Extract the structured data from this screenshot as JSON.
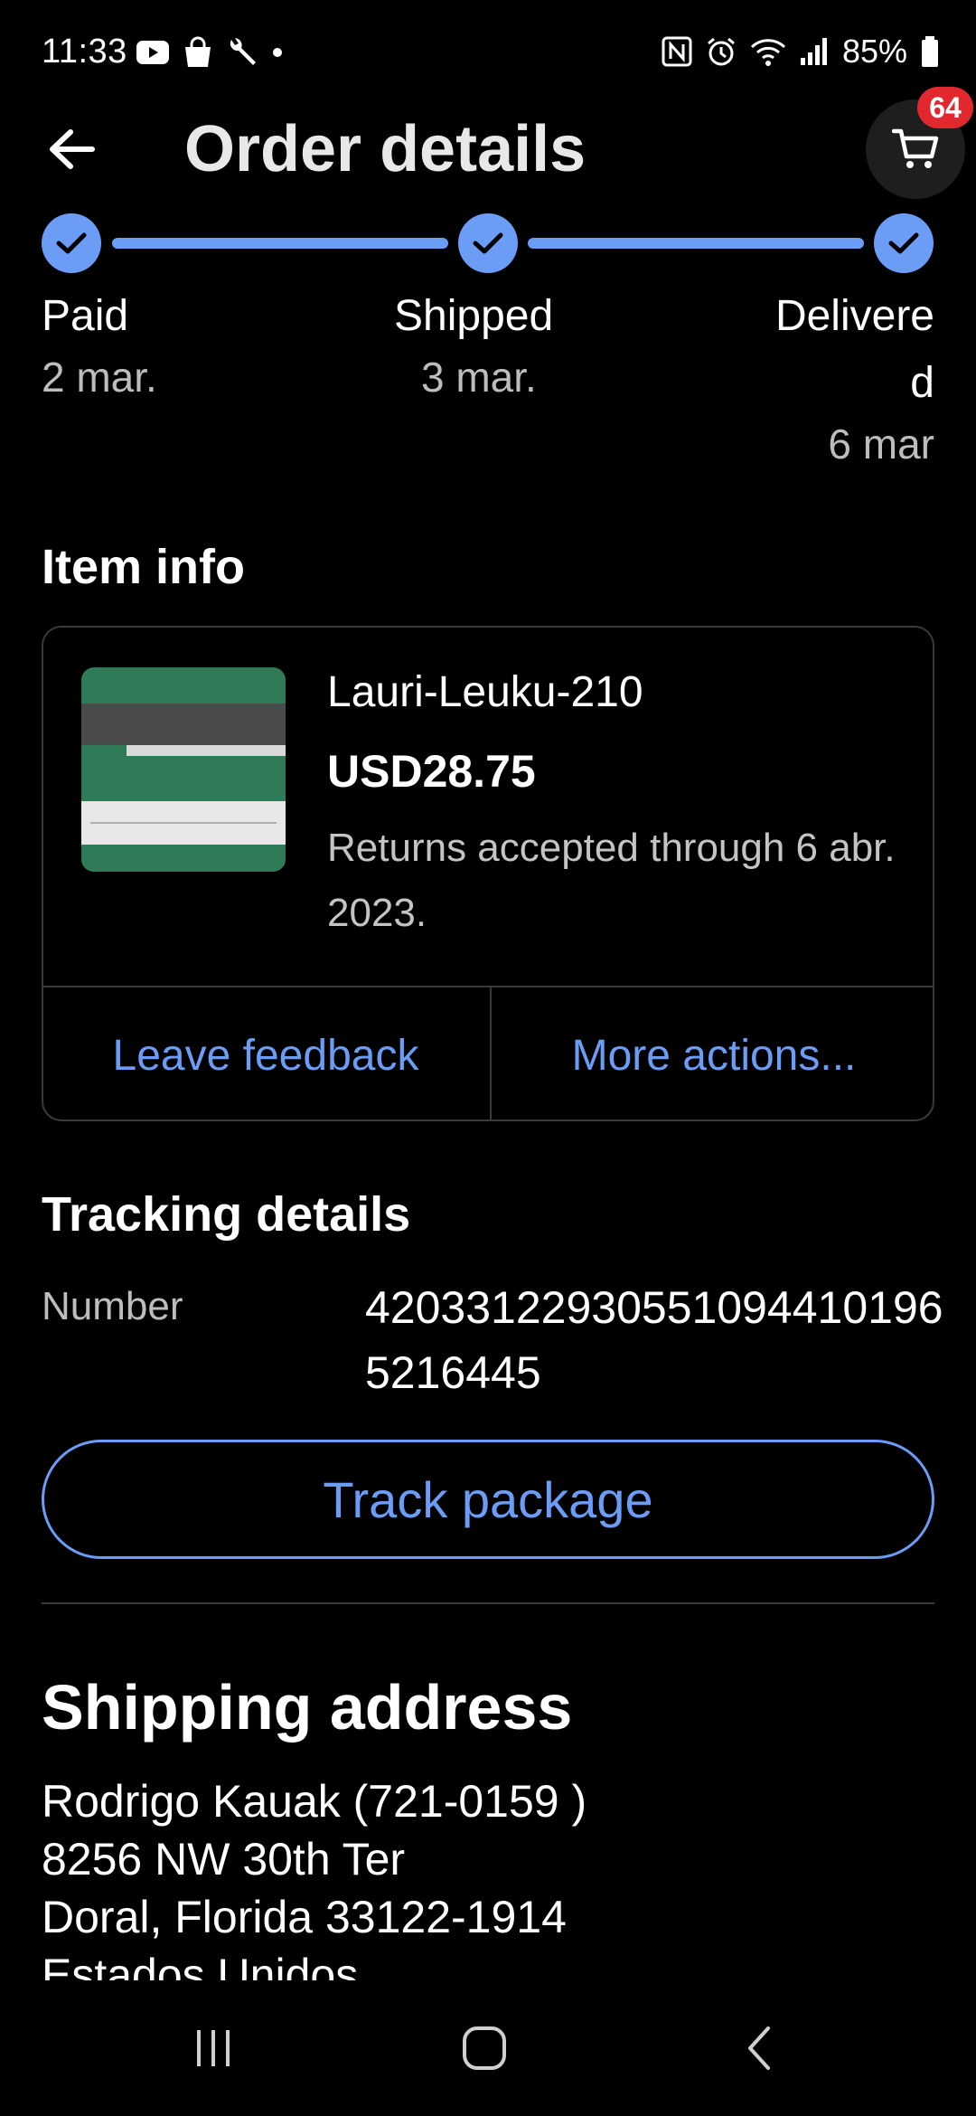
{
  "status_bar": {
    "time": "11:33",
    "battery": "85%",
    "left_icons": [
      "youtube-icon",
      "shopping-bag-icon",
      "wrench-icon",
      "dot-icon"
    ],
    "right_icons": [
      "nfc-icon",
      "alarm-icon",
      "wifi-icon",
      "signal-icon",
      "battery-icon"
    ]
  },
  "header": {
    "title": "Order details",
    "cart_count": "64"
  },
  "progress": {
    "steps": [
      {
        "label": "Paid",
        "date": "2 mar.",
        "done": true
      },
      {
        "label": "Shipped",
        "date": "3 mar.",
        "done": true
      },
      {
        "label_line1": "Delivere",
        "label_line2": "d",
        "date": "6 mar",
        "done": true
      }
    ]
  },
  "item_info": {
    "section_title": "Item info",
    "title": "Lauri-Leuku-210",
    "price": "USD28.75",
    "returns": " Returns accepted through 6 abr. 2023.",
    "actions": {
      "leave_feedback": "Leave feedback",
      "more_actions": "More actions..."
    }
  },
  "tracking": {
    "section_title": "Tracking details",
    "number_label": "Number",
    "number": "420331229305510944101965216445",
    "track_button": "Track package"
  },
  "shipping": {
    "section_title": "Shipping address",
    "lines": [
      "Rodrigo Kauak (721-0159 )",
      "8256 NW 30th Ter",
      "Doral, Florida 33122-1914",
      "Estados Unidos"
    ]
  },
  "colors": {
    "accent": "#6b9df7",
    "badge": "#e0282e",
    "background": "#000000",
    "secondary_text": "#bdbdbd",
    "border": "#3a3a3a"
  }
}
